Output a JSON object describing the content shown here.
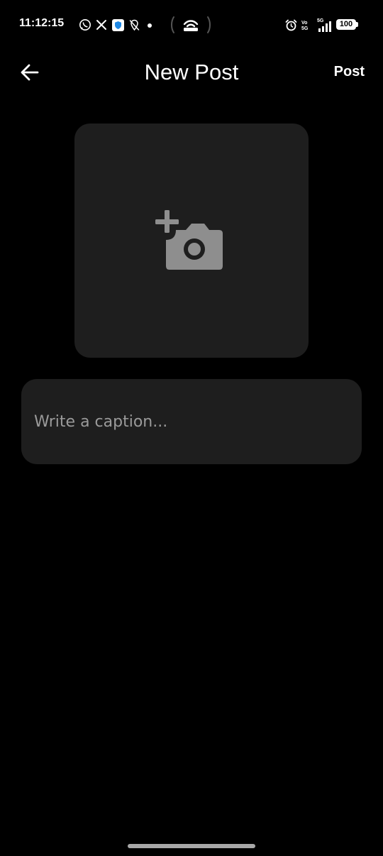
{
  "status_bar": {
    "time": "11:12:15",
    "icons": [
      "whatsapp-icon",
      "x-icon",
      "vpn-shield-icon",
      "location-off-icon",
      "dot-icon",
      "hotspot-icon",
      "alarm-icon",
      "volte-icon",
      "5g-signal-icon",
      "battery-icon"
    ],
    "volte_top": "Vo",
    "volte_bottom": "5G",
    "network": "5G",
    "battery": "100"
  },
  "app_bar": {
    "back_icon": "arrow-back-icon",
    "title": "New Post",
    "post_label": "Post"
  },
  "image_picker": {
    "icon": "add-photo-icon"
  },
  "caption": {
    "placeholder": "Write a caption...",
    "value": ""
  },
  "colors": {
    "background": "#000000",
    "surface": "#1e1e1e",
    "icon_gray": "#8e8e8e",
    "placeholder": "#9a9a9a",
    "text": "#ffffff"
  }
}
